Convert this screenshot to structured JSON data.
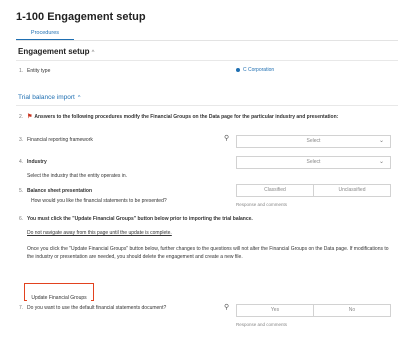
{
  "header": {
    "title": "1-100 Engagement setup"
  },
  "tabs": [
    {
      "label": "Procedures"
    }
  ],
  "engagement_setup": {
    "title": "Engagement setup",
    "items": [
      {
        "num": "1.",
        "label": "Entity type",
        "value": "C Corporation"
      }
    ]
  },
  "trial_balance": {
    "title": "Trial balance import",
    "q2": {
      "num": "2.",
      "text": "Answers to the following procedures modify the Financial Groups on the Data page for the particular industry and presentation:"
    },
    "q3": {
      "num": "3.",
      "label": "Financial reporting framework",
      "select": "Select"
    },
    "q4": {
      "num": "4.",
      "label": "Industry",
      "select": "Select",
      "help": "Select the industry that the entity operates in."
    },
    "q5": {
      "num": "5.",
      "label": "Balance sheet presentation",
      "question": "How would you like the financial statements to be presented?",
      "options": [
        "Classified",
        "Unclassified"
      ],
      "response_label": "Response and comments"
    },
    "q6": {
      "num": "6.",
      "text": "You must click the \"Update Financial Groups\" button below prior to importing the trial balance.",
      "warning": "Do not navigate away from this page until the update is complete.",
      "note": "Once you click the \"Update Financial Groups\" button below, further changes to the questions will not alter the Financial Groups on the Data page. If modifications to the industry or presentation are needed, you should delete the engagement and create a new file.",
      "button": "Update Financial Groups"
    },
    "q7": {
      "num": "7.",
      "question": "Do you want to use the default financial statements document?",
      "options": [
        "Yes",
        "No"
      ],
      "response_label": "Response and comments"
    }
  },
  "colors": {
    "accent": "#1f6fb2",
    "highlight": "#e2421f",
    "flag": "#c8321e"
  },
  "icons": {
    "chevron": "chevron-up-icon",
    "dropdown": "chevron-down-icon",
    "tip": "lightbulb-icon",
    "flag": "flag-icon"
  }
}
